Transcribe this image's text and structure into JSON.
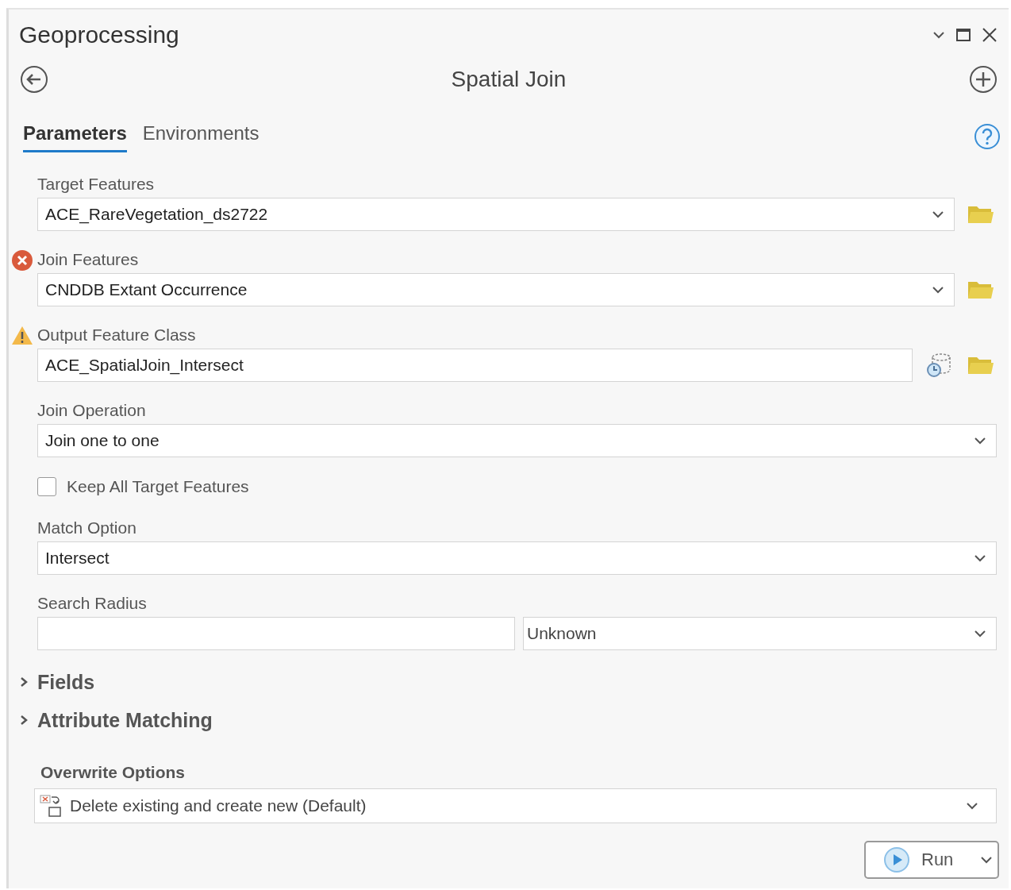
{
  "window": {
    "title": "Geoprocessing"
  },
  "tool": {
    "title": "Spatial Join"
  },
  "tabs": [
    {
      "label": "Parameters",
      "selected": true
    },
    {
      "label": "Environments",
      "selected": false
    }
  ],
  "parameters": [
    {
      "kind": "dropdown",
      "label": "Target Features",
      "value": "ACE_RareVegetation_ds2722",
      "error": false,
      "warning": false,
      "dataset_button": false,
      "browse_button": true
    },
    {
      "kind": "dropdown",
      "label": "Join Features",
      "value": "CNDDB Extant Occurrence",
      "error": true,
      "warning": false,
      "dataset_button": false,
      "browse_button": true
    },
    {
      "kind": "text",
      "label": "Output Feature Class",
      "value": "ACE_SpatialJoin_Intersect",
      "error": false,
      "warning": true,
      "dataset_button": true,
      "browse_button": true
    },
    {
      "kind": "dropdown",
      "label": "Join Operation",
      "value": "Join one to one",
      "error": false,
      "warning": false,
      "dataset_button": false,
      "browse_button": false
    },
    {
      "kind": "checkbox",
      "label": "Keep All Target Features",
      "checked": false
    },
    {
      "kind": "dropdown",
      "label": "Match Option",
      "value": "Intersect",
      "error": false,
      "warning": false,
      "dataset_button": false,
      "browse_button": false
    },
    {
      "kind": "linear_unit",
      "label": "Search Radius",
      "unit": "Unknown",
      "error": false,
      "warning": false
    }
  ],
  "sections": [
    {
      "label": "Fields",
      "expanded": false
    },
    {
      "label": "Attribute Matching",
      "expanded": false
    }
  ],
  "overwrite": {
    "label": "Overwrite Options",
    "value": "Delete existing and create new (Default)"
  },
  "run_button": {
    "label": "Run"
  }
}
